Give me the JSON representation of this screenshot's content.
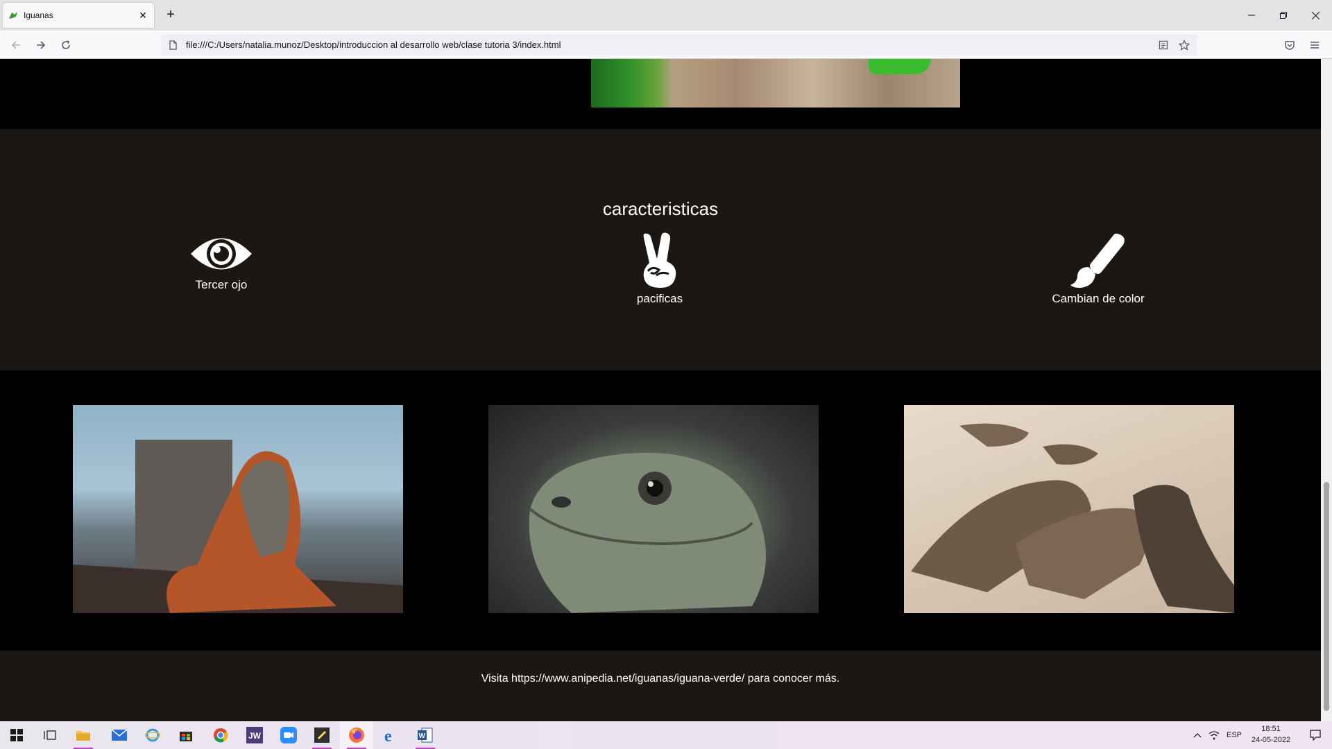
{
  "browser": {
    "tab_title": "Iguanas",
    "url": "file:///C:/Users/natalia.munoz/Desktop/introduccion al desarrollo web/clase tutoria 3/index.html"
  },
  "features": {
    "heading": "caracteristicas",
    "items": [
      {
        "icon": "eye-icon",
        "label": "Tercer ojo"
      },
      {
        "icon": "peace-hand-icon",
        "label": "pacificas"
      },
      {
        "icon": "paint-brush-icon",
        "label": "Cambian de color"
      }
    ]
  },
  "footer": {
    "text": "Visita https://www.anipedia.net/iguanas/iguana-verde/ para conocer más."
  },
  "taskbar": {
    "language": "ESP",
    "time": "18:51",
    "date": "24-05-2022"
  }
}
